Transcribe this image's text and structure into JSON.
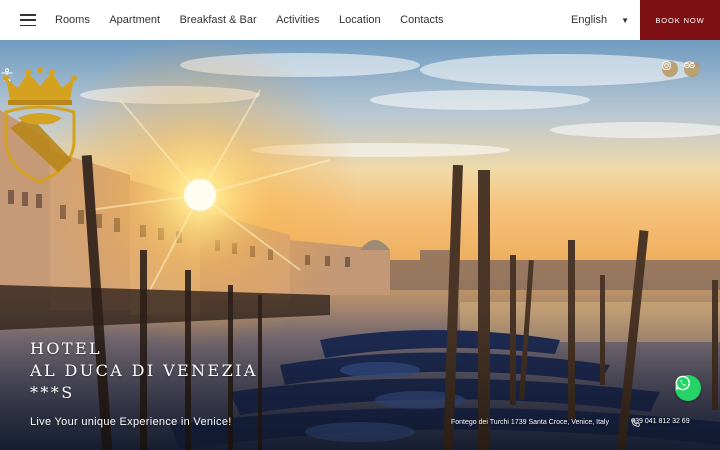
{
  "nav": {
    "items": [
      {
        "label": "Rooms"
      },
      {
        "label": "Apartment"
      },
      {
        "label": "Breakfast & Bar"
      },
      {
        "label": "Activities"
      },
      {
        "label": "Location"
      },
      {
        "label": "Contacts"
      }
    ],
    "language": "English",
    "book_label": "BOOK NOW"
  },
  "hero": {
    "title_line1": "HOTEL",
    "title_line2": "AL DUCA DI VENEZIA",
    "title_line3": "***S",
    "tagline": "Live Your unique Experience in Venice!",
    "address": "Fontego dei Turchi 1739 Santa Croce, Venice, Italy",
    "phone": "+39 041 812 32 69"
  },
  "icons": {
    "menu": "hamburger-icon",
    "accessibility": "accessibility-icon",
    "instagram": "instagram-icon",
    "tripadvisor": "tripadvisor-icon",
    "phone": "phone-icon",
    "whatsapp": "whatsapp-icon"
  },
  "colors": {
    "book_button": "#7e0f12",
    "logo_gold": "#d4a21f",
    "whatsapp": "#25d366"
  }
}
